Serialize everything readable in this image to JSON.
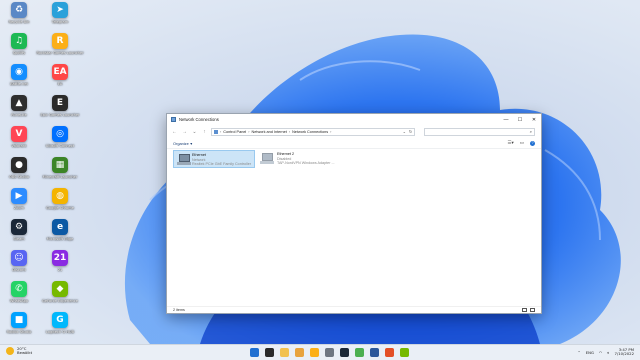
{
  "desktop": {
    "icons": [
      {
        "label": "Recycle Bin",
        "color": "#5a88c6",
        "glyph": "♻",
        "name": "recycle-bin-icon"
      },
      {
        "label": "Spotify",
        "color": "#1db954",
        "glyph": "♫",
        "name": "spotify-icon"
      },
      {
        "label": "Battle.net",
        "color": "#148eff",
        "glyph": "◉",
        "name": "battlenet-icon"
      },
      {
        "label": "RuneLite",
        "color": "#2e2e2e",
        "glyph": "▲",
        "name": "runelite-icon"
      },
      {
        "label": "Valorant",
        "color": "#ff4655",
        "glyph": "V",
        "name": "valorant-icon"
      },
      {
        "label": "OBS Studio",
        "color": "#2b2b2b",
        "glyph": "●",
        "name": "obs-icon"
      },
      {
        "label": "Zoom",
        "color": "#2d8cff",
        "glyph": "▶",
        "name": "zoom-icon"
      },
      {
        "label": "Steam",
        "color": "#1b2838",
        "glyph": "⚙",
        "name": "steam-icon"
      },
      {
        "label": "Discord",
        "color": "#5865f2",
        "glyph": "☺",
        "name": "discord-icon"
      },
      {
        "label": "WhatsApp",
        "color": "#25d366",
        "glyph": "✆",
        "name": "whatsapp-icon"
      },
      {
        "label": "Roblox Studio",
        "color": "#00a2ff",
        "glyph": "■",
        "name": "roblox-studio-icon"
      },
      {
        "label": "Telegram",
        "color": "#2aa1da",
        "glyph": "➤",
        "name": "telegram-icon"
      },
      {
        "label": "Rockstar Games Launcher",
        "color": "#fcaf17",
        "glyph": "R",
        "name": "rockstar-icon"
      },
      {
        "label": "EA",
        "color": "#ff4747",
        "glyph": "EA",
        "name": "ea-icon"
      },
      {
        "label": "Epic Games Launcher",
        "color": "#2a2a2a",
        "glyph": "E",
        "name": "epic-games-icon"
      },
      {
        "label": "Ubisoft Connect",
        "color": "#0070ff",
        "glyph": "◎",
        "name": "ubisoft-icon"
      },
      {
        "label": "Minecraft Launcher",
        "color": "#3c8527",
        "glyph": "▦",
        "name": "minecraft-icon"
      },
      {
        "label": "Google Chrome",
        "color": "#f4b400",
        "glyph": "◍",
        "name": "chrome-icon"
      },
      {
        "label": "Microsoft Edge",
        "color": "#0c59a4",
        "glyph": "e",
        "name": "edge-icon"
      },
      {
        "label": "21",
        "color": "#8a2be2",
        "glyph": "21",
        "name": "app-21-icon"
      },
      {
        "label": "GeForce Experience",
        "color": "#76b900",
        "glyph": "◆",
        "name": "geforce-icon"
      },
      {
        "label": "Logitech G HUB",
        "color": "#00b8fc",
        "glyph": "G",
        "name": "ghub-icon"
      }
    ]
  },
  "window": {
    "title": "Network Connections",
    "minimize": "—",
    "maximize": "☐",
    "close": "✕",
    "nav": {
      "back": "←",
      "forward": "→",
      "down": "⌄",
      "up": "↑"
    },
    "breadcrumb": [
      "Control Panel",
      "Network and Internet",
      "Network Connections"
    ],
    "search_icon": "⌕",
    "organize_label": "Organize",
    "connections": [
      {
        "name": "Ethernet",
        "status": "Network",
        "device": "Realtek PCIe GbE Family Controller",
        "selected": true
      },
      {
        "name": "Ethernet 2",
        "status": "Disabled",
        "device": "TAP-NordVPN Windows Adapter ...",
        "selected": false
      }
    ],
    "status_text": "2 items"
  },
  "taskbar": {
    "weather_temp": "20°C",
    "weather_desc": "Bewölkt",
    "lang": "ENG",
    "time": "3:47 PM",
    "date": "7/10/2022",
    "apps": [
      "#1f6fd1",
      "#2a2a2a",
      "#f2c14e",
      "#e8a33d",
      "#fcaf17",
      "#6e7681",
      "#1b2838",
      "#4caf50",
      "#2b579a",
      "#e34f26",
      "#76b900"
    ]
  }
}
